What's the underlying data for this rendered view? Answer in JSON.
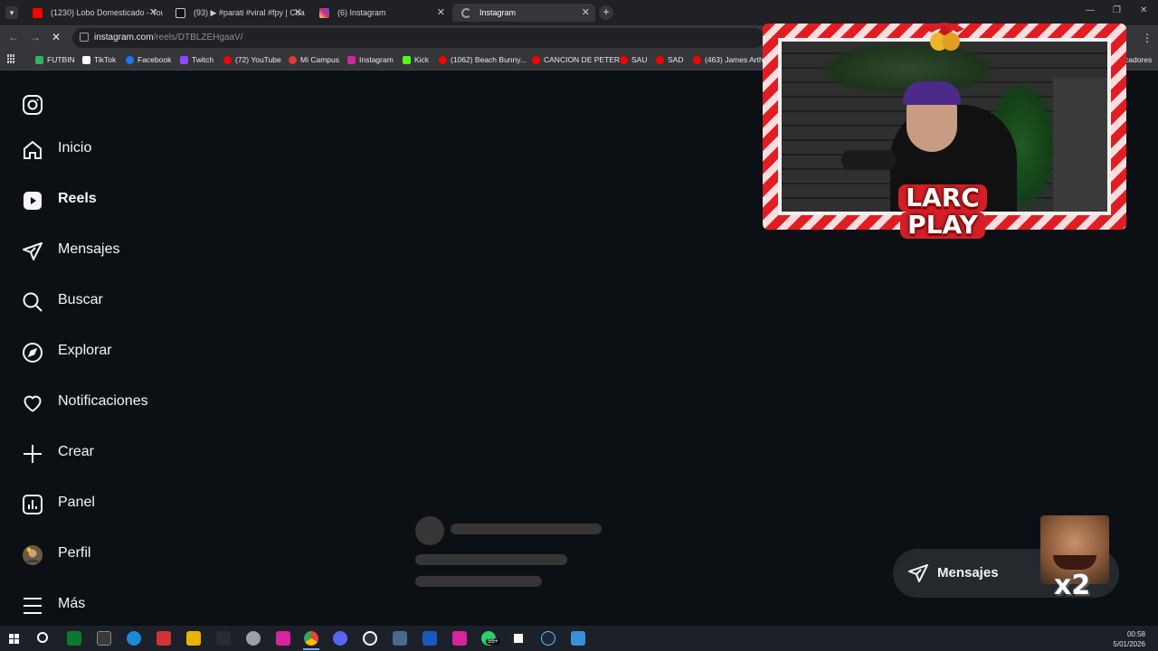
{
  "tabs": [
    {
      "title": "(1230) Lobo Domesticado - You",
      "favicon": "youtube-icon",
      "color": "#ff0000"
    },
    {
      "title": "(93) ▶ #parati #viral #fpy | Cua",
      "favicon": "tiktok-icon",
      "color": "#ffffff"
    },
    {
      "title": "(6) Instagram",
      "favicon": "instagram-icon",
      "color": "#d6249f"
    },
    {
      "title": "Instagram",
      "favicon": "loading-icon",
      "color": "#9aa0a6"
    }
  ],
  "address_bar": {
    "host": "instagram.com",
    "path": "/reels/DTBLZEHgaaV/"
  },
  "bookmarks": [
    {
      "label": "FUTBIN",
      "icon": "futbin-icon",
      "color": "#2fb36b"
    },
    {
      "label": "TikTok",
      "icon": "tiktok-icon",
      "color": "#ffffff"
    },
    {
      "label": "Facebook",
      "icon": "facebook-icon",
      "color": "#1877f2"
    },
    {
      "label": "Twitch",
      "icon": "twitch-icon",
      "color": "#9146ff"
    },
    {
      "label": "(72) YouTube",
      "icon": "youtube-icon",
      "color": "#ff0000"
    },
    {
      "label": "Mi Campus",
      "icon": "campus-icon",
      "color": "#e53935"
    },
    {
      "label": "Instagram",
      "icon": "instagram-icon",
      "color": "#d6249f"
    },
    {
      "label": "Kick",
      "icon": "kick-icon",
      "color": "#53fc18"
    },
    {
      "label": "(1062) Beach Bunny...",
      "icon": "youtube-icon",
      "color": "#ff0000"
    },
    {
      "label": "CANCION DE PETER",
      "icon": "youtube-icon",
      "color": "#ff0000"
    },
    {
      "label": "SAU",
      "icon": "youtube-icon",
      "color": "#ff0000"
    },
    {
      "label": "SAD",
      "icon": "youtube-icon",
      "color": "#ff0000"
    },
    {
      "label": "(463) James Arthur",
      "icon": "youtube-icon",
      "color": "#ff0000"
    }
  ],
  "bookmarks_overflow": "cadores",
  "sidebar": {
    "items": [
      {
        "label": "Inicio",
        "icon": "home-icon"
      },
      {
        "label": "Reels",
        "icon": "reels-icon"
      },
      {
        "label": "Mensajes",
        "icon": "messages-icon"
      },
      {
        "label": "Buscar",
        "icon": "search-icon"
      },
      {
        "label": "Explorar",
        "icon": "explore-icon"
      },
      {
        "label": "Notificaciones",
        "icon": "heart-icon"
      },
      {
        "label": "Crear",
        "icon": "plus-icon"
      },
      {
        "label": "Panel",
        "icon": "dashboard-icon"
      },
      {
        "label": "Perfil",
        "icon": "avatar-icon"
      },
      {
        "label": "Más",
        "icon": "menu-icon"
      }
    ]
  },
  "stream_overlay": {
    "logo_line1": "LARC",
    "logo_line2": "PLAY",
    "emote_badge": "x2"
  },
  "messages_button": {
    "label": "Mensajes"
  },
  "taskbar": {
    "time": "00:58",
    "date": "5/01/2026",
    "whatsapp_badge": "99+"
  },
  "colors": {
    "background": "#0c1014",
    "frame_red": "#e11d24",
    "chrome_dark": "#202124"
  }
}
